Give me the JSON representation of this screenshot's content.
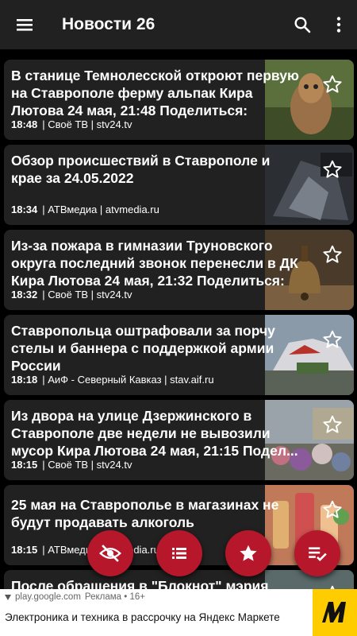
{
  "appbar": {
    "title": "Новости 26",
    "menu_icon": "hamburger-menu-icon",
    "search_icon": "search-icon",
    "more_icon": "more-vert-icon"
  },
  "articles": [
    {
      "headline": "В станице Темнолесской откроют первую на Ставрополе ферму альпак Кира Лютова 24 мая, 21:48 Поделиться:",
      "time": "18:48",
      "source": "| Своё ТВ | stv24.tv"
    },
    {
      "headline": "Обзор происшествий в Ставрополе и крае за 24.05.2022",
      "time": "18:34",
      "source": "| АТВмедиа | atvmedia.ru"
    },
    {
      "headline": "Из-за пожара в гимназии Труновского округа последний звонок перенесли в ДК Кира Лютова 24 мая, 21:32 Поделиться:",
      "time": "18:32",
      "source": "| Своё ТВ | stv24.tv"
    },
    {
      "headline": "Ставропольца оштрафовали за порчу стелы и баннера с поддержкой армии России",
      "time": "18:18",
      "source": "| АиФ - Северный Кавказ | stav.aif.ru"
    },
    {
      "headline": "Из двора на улице Дзержинского в Ставрополе две недели не вывозили мусор Кира Лютова 24 мая, 21:15 Подел...",
      "time": "18:15",
      "source": "| Своё ТВ | stv24.tv"
    },
    {
      "headline": "25 мая на Ставрополье в магазинах не будут продавать алкоголь",
      "time": "18:15",
      "source": "| АТВмедиа | atvmedia.ru"
    },
    {
      "headline": "После обращения в \"Блокнот\" мэрия",
      "time": "",
      "source": ""
    }
  ],
  "fabs": {
    "hide_icon": "visibility-off-icon",
    "list_icon": "list-icon",
    "favorites_icon": "star-icon",
    "read_icon": "playlist-check-icon"
  },
  "ad": {
    "domain": "play.google.com",
    "label": "Реклама • 16+",
    "headline": "Электроника и техника в рассрочку на Яндекс Маркете",
    "logo_icon": "yandex-market-logo-icon"
  },
  "colors": {
    "background": "#000000",
    "card": "#212121",
    "accent": "#b7172b",
    "ad_logo": "#ffcc00"
  }
}
